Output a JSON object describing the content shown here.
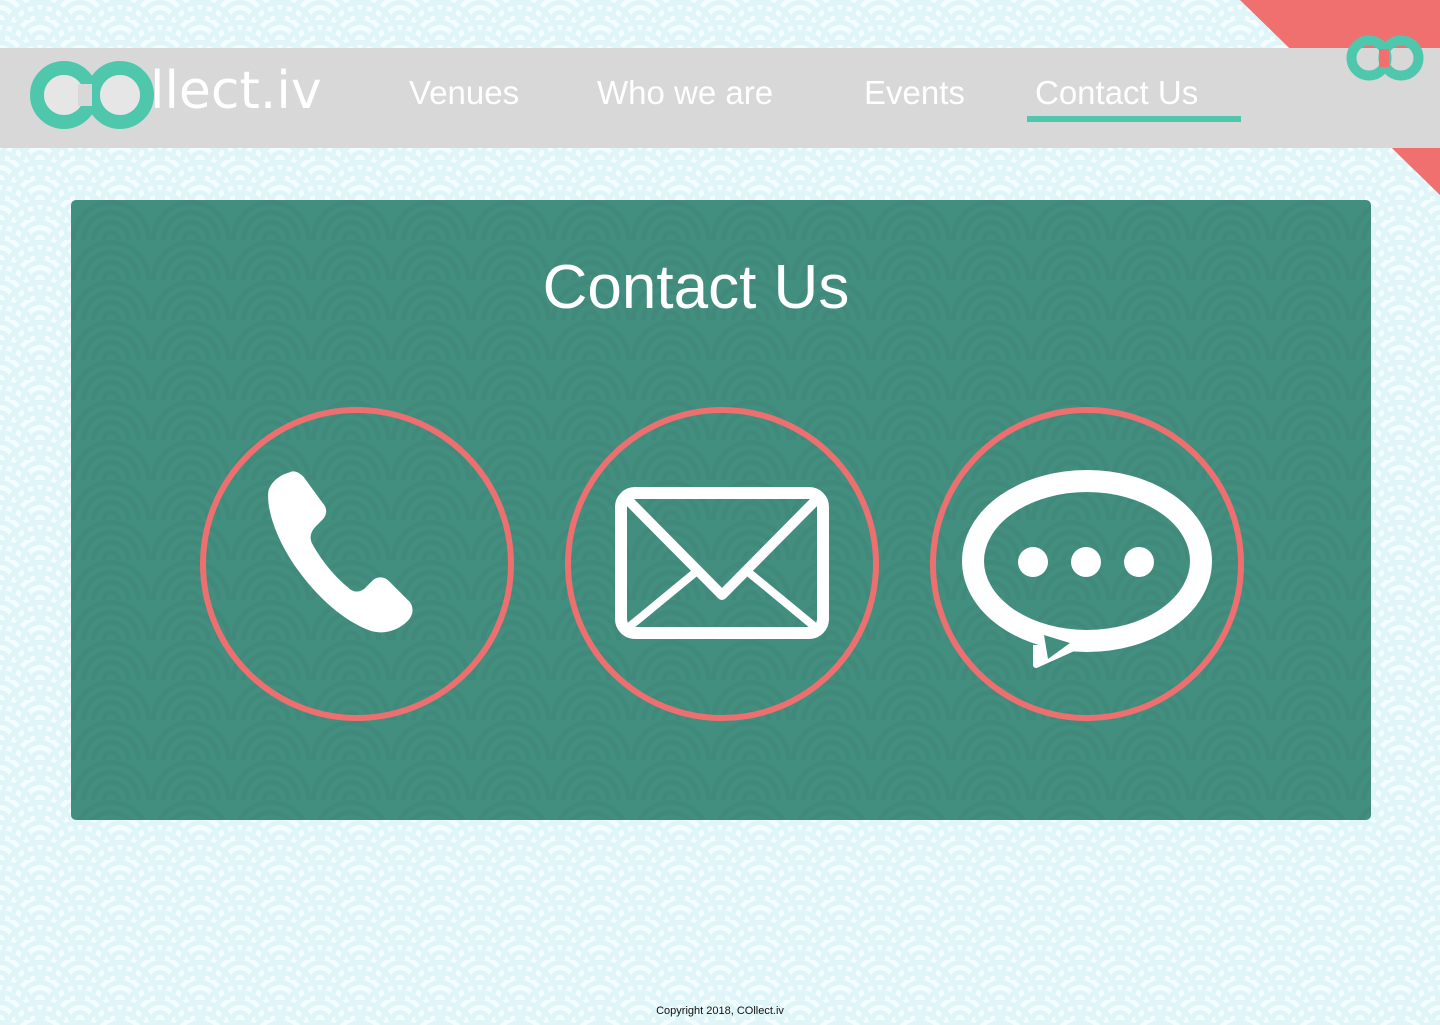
{
  "brand": {
    "text": "llect.iv",
    "logo_icon": "co-rings-logo-icon",
    "accent_color": "#4fc7ad"
  },
  "corner": {
    "color": "#f07070",
    "icon": "co-rings-logo-icon"
  },
  "nav": {
    "items": [
      {
        "label": "Venues"
      },
      {
        "label": "Who we are"
      },
      {
        "label": "Events"
      },
      {
        "label": "Contact Us",
        "active": true
      }
    ]
  },
  "main": {
    "title": "Contact Us",
    "panel_color": "#438f7f",
    "ring_color": "#ee6f6f",
    "contact_options": [
      {
        "icon": "phone-icon"
      },
      {
        "icon": "envelope-icon"
      },
      {
        "icon": "chat-bubble-icon"
      }
    ]
  },
  "footer": {
    "copyright": "Copyright 2018, COllect.iv"
  }
}
